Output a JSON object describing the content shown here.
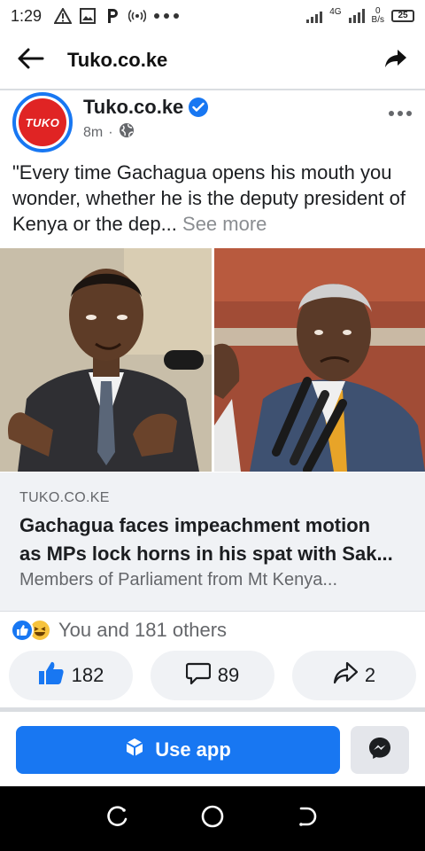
{
  "status_bar": {
    "time": "1:29",
    "network": "4G",
    "net_speed_value": "0",
    "net_speed_unit": "B/s",
    "battery": "25"
  },
  "app_bar": {
    "title": "Tuko.co.ke",
    "back_icon": "arrow-left-icon",
    "share_icon": "share-arrow-icon"
  },
  "post": {
    "page_name": "Tuko.co.ke",
    "avatar_text": "TUKO",
    "time_ago": "8m",
    "separator": "·",
    "privacy_icon": "globe-icon",
    "caption": "\"Every time Gachagua opens his mouth you wonder, whether he is the deputy president of Kenya or the dep...",
    "see_more": " See more"
  },
  "link_card": {
    "domain": "TUKO.CO.KE",
    "title_line1": "Gachagua faces impeachment motion",
    "title_line2": "as MPs lock horns in his spat with Sak...",
    "description": "Members of Parliament from Mt Kenya..."
  },
  "reactions": {
    "summary": "You and 181 others"
  },
  "actions": {
    "like_count": "182",
    "comment_count": "89",
    "share_count": "2"
  },
  "cta": {
    "use_app_label": "Use app"
  },
  "colors": {
    "brand_blue": "#1877f2",
    "tuko_red": "#e02424"
  }
}
